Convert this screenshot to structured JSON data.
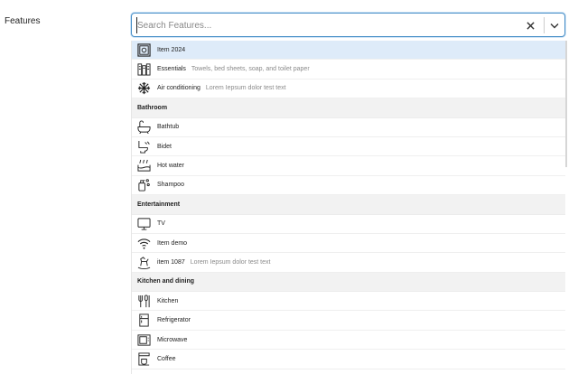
{
  "form": {
    "label": "Features"
  },
  "search": {
    "placeholder": "Search Features..."
  },
  "top_options": [
    {
      "label": "Item 2024",
      "desc": "",
      "icon": "safe-icon"
    },
    {
      "label": "Essentials",
      "desc": "Towels, bed sheets, soap, and toilet paper",
      "icon": "essentials-icon"
    },
    {
      "label": "Air conditioning",
      "desc": "Lorem Iepsum dolor test text",
      "icon": "snowflake-icon"
    }
  ],
  "groups": [
    {
      "title": "Bathroom",
      "options": [
        {
          "label": "Bathtub",
          "icon": "bathtub-icon"
        },
        {
          "label": "Bidet",
          "icon": "bidet-icon"
        },
        {
          "label": "Hot water",
          "icon": "hot-water-icon"
        },
        {
          "label": "Shampoo",
          "icon": "shampoo-icon"
        }
      ]
    },
    {
      "title": "Entertainment",
      "options": [
        {
          "label": "TV",
          "icon": "tv-icon"
        },
        {
          "label": "Item demo",
          "icon": "wifi-icon"
        },
        {
          "label": "item 1087",
          "desc": "Lorem Iepsum dolor test text",
          "icon": "rocking-horse-icon"
        }
      ]
    },
    {
      "title": "Kitchen and dining",
      "options": [
        {
          "label": "Kitchen",
          "icon": "utensils-icon"
        },
        {
          "label": "Refrigerator",
          "icon": "refrigerator-icon"
        },
        {
          "label": "Microwave",
          "icon": "microwave-icon"
        },
        {
          "label": "Coffee",
          "icon": "coffee-maker-icon"
        }
      ]
    }
  ]
}
